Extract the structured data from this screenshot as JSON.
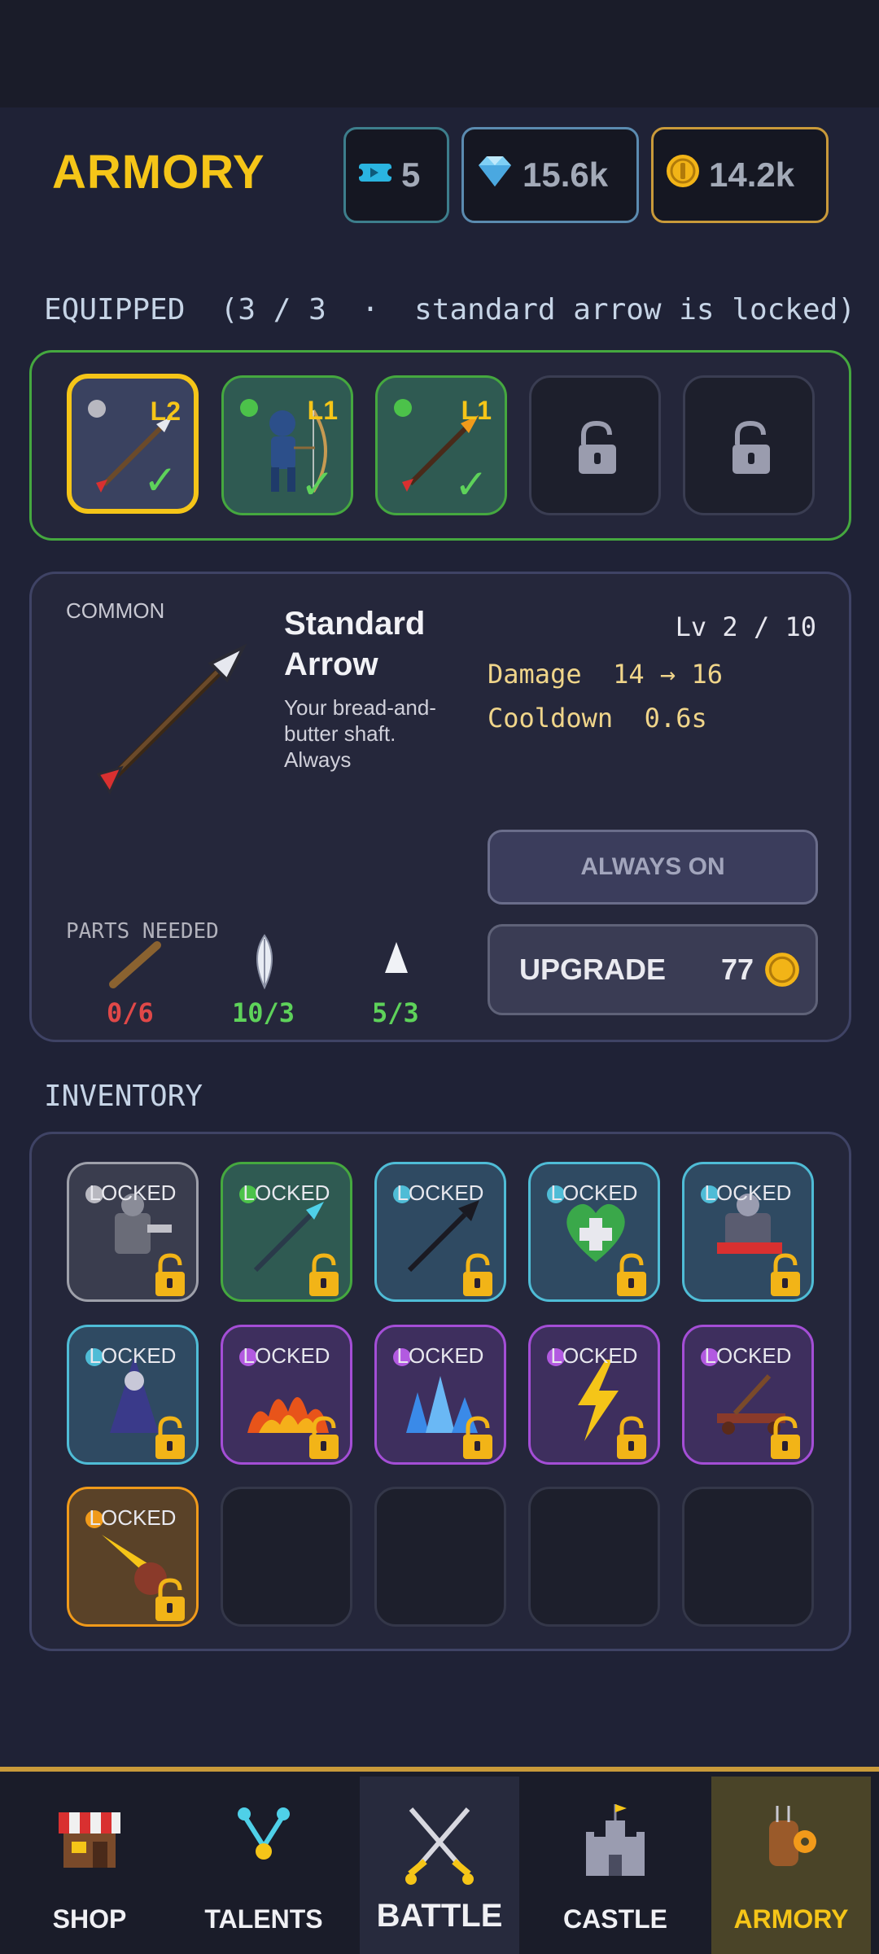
{
  "header": {
    "title": "ARMORY",
    "tickets": "5",
    "gems": "15.6k",
    "gold": "14.2k"
  },
  "equipped": {
    "banner": "EQUIPPED  (3 / 3  ·  standard arrow is locked)",
    "slots": [
      {
        "level": "L2",
        "dot_color": "#b8b8c0",
        "icon": "arrow-icon",
        "selected": true
      },
      {
        "level": "L1",
        "dot_color": "#4cc24a",
        "icon": "archer-icon",
        "selected": false
      },
      {
        "level": "L1",
        "dot_color": "#4cc24a",
        "icon": "fire-arrow-icon",
        "selected": false
      },
      {
        "icon": "lock-icon"
      },
      {
        "icon": "lock-icon"
      }
    ]
  },
  "detail": {
    "rarity": "COMMON",
    "name": "Standard Arrow",
    "description": "Your bread-and-butter shaft. Always",
    "level": "Lv 2 / 10",
    "stats": [
      {
        "label": "Damage",
        "value": "14 → 16"
      },
      {
        "label": "Cooldown",
        "value": "0.6s"
      }
    ],
    "always_on_label": "ALWAYS ON",
    "upgrade_label": "UPGRADE",
    "upgrade_cost": "77",
    "parts_label": "PARTS NEEDED",
    "parts": [
      {
        "icon": "shaft-icon",
        "count": "0/6",
        "color": "#e04848"
      },
      {
        "icon": "feather-icon",
        "count": "10/3",
        "color": "#5ed25a"
      },
      {
        "icon": "arrowhead-icon",
        "count": "5/3",
        "color": "#5ed25a"
      }
    ]
  },
  "inventory": {
    "title": "INVENTORY",
    "locked_label": "LOCKED",
    "items": [
      {
        "icon": "gunner-icon",
        "rarity": "common",
        "border": "#9ea0aa",
        "dot": "#b8b8c0"
      },
      {
        "icon": "ice-arrow-icon",
        "rarity": "uncommon",
        "border": "#45a83f",
        "dot": "#4cc24a"
      },
      {
        "icon": "trident-arrow-icon",
        "rarity": "rare",
        "border": "#4fbcd6",
        "dot": "#4fbcd6"
      },
      {
        "icon": "heal-icon",
        "rarity": "rare",
        "border": "#4fbcd6",
        "dot": "#4fbcd6"
      },
      {
        "icon": "knight-icon",
        "rarity": "rare",
        "border": "#4fbcd6",
        "dot": "#4fbcd6"
      },
      {
        "icon": "wizard-icon",
        "rarity": "rare",
        "border": "#4fbcd6",
        "dot": "#4fbcd6"
      },
      {
        "icon": "fire-icon",
        "rarity": "epic",
        "border": "#a44ed6",
        "dot": "#b25ae0"
      },
      {
        "icon": "ice-spikes-icon",
        "rarity": "epic",
        "border": "#a44ed6",
        "dot": "#b25ae0"
      },
      {
        "icon": "lightning-icon",
        "rarity": "epic",
        "border": "#a44ed6",
        "dot": "#b25ae0"
      },
      {
        "icon": "catapult-icon",
        "rarity": "epic",
        "border": "#a44ed6",
        "dot": "#b25ae0"
      },
      {
        "icon": "meteor-icon",
        "rarity": "legendary",
        "border": "#f09a1a",
        "dot": "#f09a1a"
      }
    ]
  },
  "nav": [
    {
      "label": "SHOP",
      "icon": "shop-icon"
    },
    {
      "label": "TALENTS",
      "icon": "talents-icon"
    },
    {
      "label": "BATTLE",
      "icon": "battle-icon"
    },
    {
      "label": "CASTLE",
      "icon": "castle-icon"
    },
    {
      "label": "ARMORY",
      "icon": "armory-icon",
      "active": true
    }
  ]
}
